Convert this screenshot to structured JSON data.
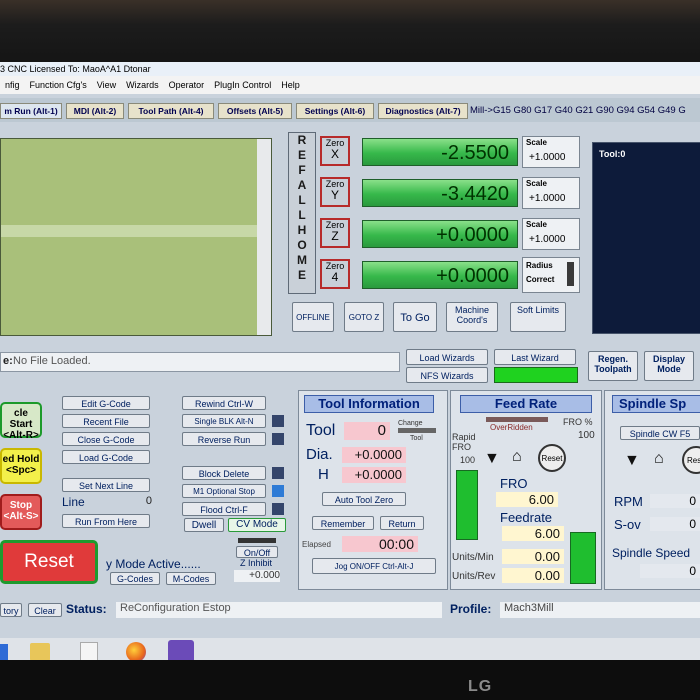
{
  "window": {
    "title": "3 CNC  Licensed To: MaoA^A1  Dtonar"
  },
  "menu": [
    "nfig",
    "Function Cfg's",
    "View",
    "Wizards",
    "Operator",
    "PlugIn Control",
    "Help"
  ],
  "tabs": [
    "m Run (Alt-1)",
    "MDI (Alt-2)",
    "Tool Path (Alt-4)",
    "Offsets (Alt-5)",
    "Settings (Alt-6)",
    "Diagnostics (Alt-7)"
  ],
  "gcode_modes": "Mill->G15  G80 G17 G40 G21 G90 G94 G54 G49 G",
  "ref_all_home": [
    "R",
    "E",
    "F",
    "A",
    "L",
    "L",
    "H",
    "O",
    "M",
    "E"
  ],
  "axes": [
    {
      "zero_label": "Zero",
      "axis": "X",
      "value": "-2.5500",
      "scale_label": "Scale",
      "scale": "+1.0000"
    },
    {
      "zero_label": "Zero",
      "axis": "Y",
      "value": "-3.4420",
      "scale_label": "Scale",
      "scale": "+1.0000"
    },
    {
      "zero_label": "Zero",
      "axis": "Z",
      "value": "+0.0000",
      "scale_label": "Scale",
      "scale": "+1.0000"
    },
    {
      "zero_label": "Zero",
      "axis": "4",
      "value": "+0.0000",
      "scale_label": "Radius",
      "scale": "Correct"
    }
  ],
  "dro_buttons": {
    "offline": "OFFLINE",
    "gotoz": "GOTO Z",
    "togo": "To Go",
    "machine": "Machine Coord's",
    "soft": "Soft Limits"
  },
  "tool_display": "Tool:0",
  "file": {
    "label": "e:",
    "value": "No File Loaded."
  },
  "wizards": {
    "load": "Load Wizards",
    "last": "Last Wizard",
    "nfs": "NFS Wizards",
    "regen": "Regen. Toolpath",
    "display": "Display Mode"
  },
  "left_buttons": {
    "cycle": "cle Start <Alt-R>",
    "feedhold": "ed Hold <Spc>",
    "stop": "Stop <Alt-S>",
    "reset": "Reset"
  },
  "gcode_buttons": {
    "edit": "Edit G-Code",
    "recent": "Recent File",
    "close": "Close G-Code",
    "load": "Load G-Code",
    "setnext": "Set Next Line",
    "line_label": "Line",
    "line_value": "0",
    "runfrom": "Run From Here"
  },
  "middle_buttons": {
    "rewind": "Rewind Ctrl-W",
    "singleblk": "Single BLK Alt-N",
    "reverse": "Reverse Run",
    "blockdel": "Block Delete",
    "m1": "M1 Optional Stop",
    "flood": "Flood Ctrl-F",
    "dwell": "Dwell",
    "cvmode": "CV Mode"
  },
  "mode_active": {
    "text": "y Mode Active......",
    "gcodes": "G-Codes",
    "mcodes": "M-Codes",
    "onoff": "On/Off",
    "zinhibit": "Z Inhibit",
    "zvalue": "+0.000"
  },
  "tool_info": {
    "title": "Tool Information",
    "tool_label": "Tool",
    "tool_value": "0",
    "change": "Change",
    "toolsub": "Tool",
    "dia_label": "Dia.",
    "dia": "+0.0000",
    "h_label": "H",
    "h": "+0.0000",
    "autozero": "Auto Tool Zero",
    "remember": "Remember",
    "return": "Return",
    "elapsed_label": "Elapsed",
    "elapsed": "00:00",
    "jog": "Jog ON/OFF Ctrl-Alt-J"
  },
  "feed": {
    "title": "Feed Rate",
    "overridden": "OverRidden",
    "fro_pct_label": "FRO %",
    "fro_pct": "100",
    "rapid": "Rapid FRO",
    "rapid_val": "100",
    "fro_label": "FRO",
    "fro": "6.00",
    "feedrate_label": "Feedrate",
    "feedrate": "6.00",
    "reset": "Reset",
    "upm_label": "Units/Min",
    "upm": "0.00",
    "upr_label": "Units/Rev",
    "upr": "0.00"
  },
  "spindle": {
    "title": "Spindle Sp",
    "cw": "Spindle CW F5",
    "rpm_label": "RPM",
    "rpm": "0",
    "sov_label": "S-ov",
    "sov": "0",
    "speed_label": "Spindle Speed",
    "speed": "0",
    "reset": "Rese"
  },
  "status": {
    "history": "tory",
    "clear": "Clear",
    "status_label": "Status:",
    "status": "ReConfiguration Estop",
    "profile_label": "Profile:",
    "profile": "Mach3Mill"
  },
  "brand": "LG",
  "colors": {
    "dro_green": "#36b84a",
    "tab_bg": "#e7e2cb",
    "header_blue": "#a8bde6",
    "reset_red": "#e03a3a"
  }
}
